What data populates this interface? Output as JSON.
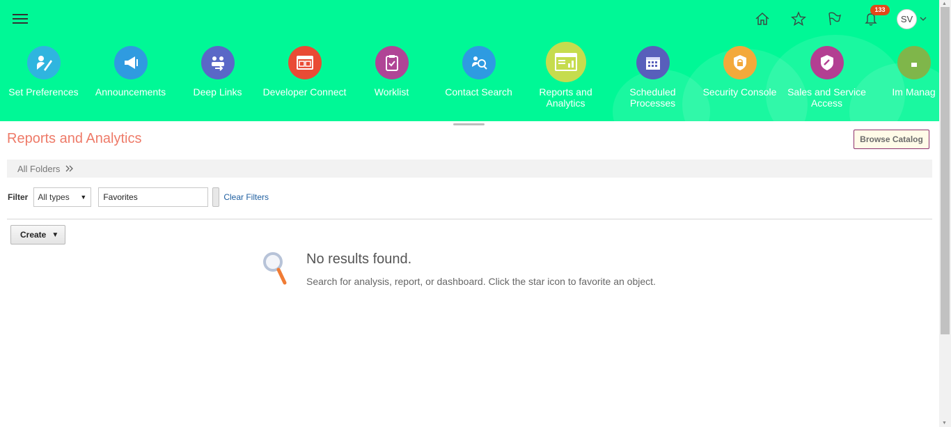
{
  "header": {
    "menu_icon": "hamburger-icon",
    "badge_count": "133",
    "avatar_initials": "SV",
    "top_icons": [
      "home-icon",
      "star-icon",
      "flag-icon",
      "bell-icon"
    ],
    "bg_color": "#00f896"
  },
  "springboard": {
    "tiles": [
      {
        "label": "Set Preferences",
        "icon": "user-edit-icon",
        "color": "#2fb5df"
      },
      {
        "label": "Announcements",
        "icon": "megaphone-icon",
        "color": "#2f9be0"
      },
      {
        "label": "Deep Links",
        "icon": "link-people-icon",
        "color": "#5a68c7"
      },
      {
        "label": "Developer Connect",
        "icon": "code-window-icon",
        "color": "#e94b35"
      },
      {
        "label": "Worklist",
        "icon": "clipboard-check-icon",
        "color": "#b04596"
      },
      {
        "label": "Contact Search",
        "icon": "people-search-icon",
        "color": "#2e9be1"
      },
      {
        "label": "Reports and Analytics",
        "icon": "report-chart-icon",
        "color": "#c6dc4e"
      },
      {
        "label": "Scheduled Processes",
        "icon": "calendar-icon",
        "color": "#585fbb"
      },
      {
        "label": "Security Console",
        "icon": "shield-lock-icon",
        "color": "#f3a93b"
      },
      {
        "label": "Sales and Service Access",
        "icon": "shield-check-icon",
        "color": "#b33f92"
      },
      {
        "label": "Im Manag",
        "icon": "partial-tile-icon",
        "color": "#7fb64a"
      }
    ]
  },
  "content": {
    "title": "Reports and Analytics",
    "browse_button": "Browse Catalog",
    "breadcrumb": "All Folders",
    "filter": {
      "label": "Filter",
      "type_value": "All types",
      "search_value": "Favorites",
      "clear_link": "Clear Filters"
    },
    "create_button": "Create",
    "no_results_title": "No results found.",
    "no_results_msg": "Search for analysis, report, or dashboard. Click the star icon to favorite an object."
  }
}
